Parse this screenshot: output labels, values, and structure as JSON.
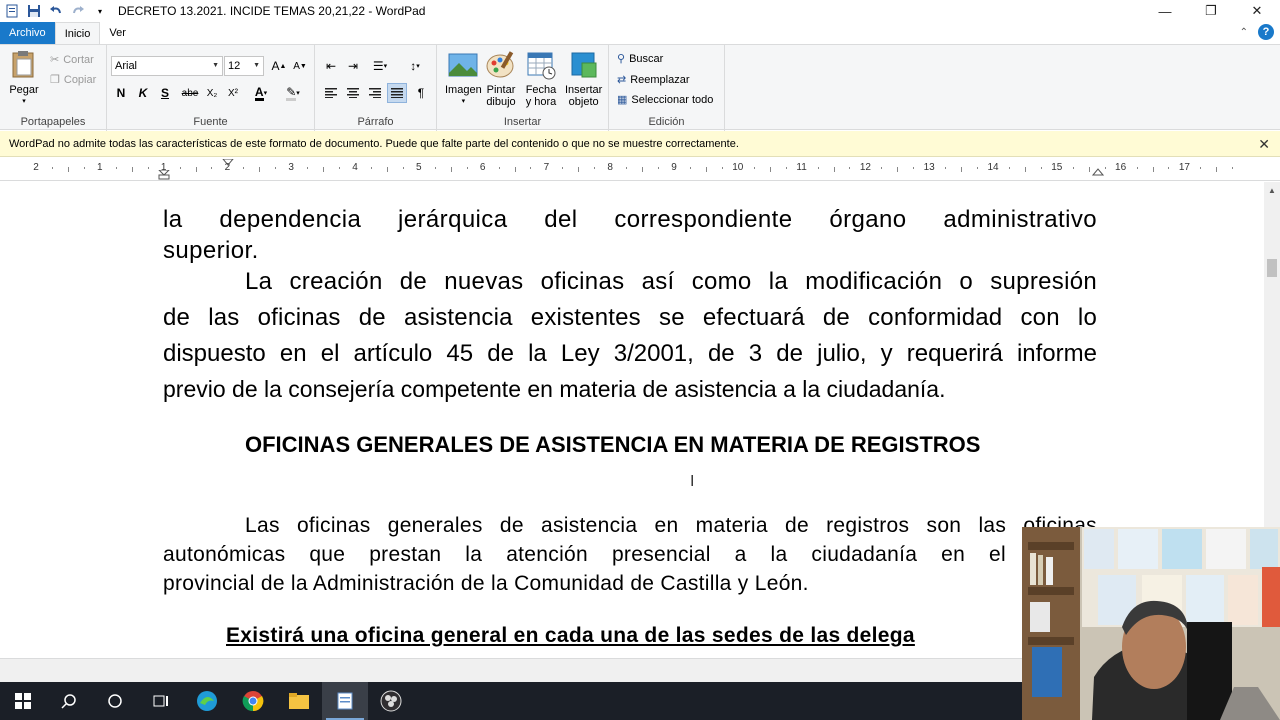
{
  "window": {
    "title": "DECRETO 13.2021. INCIDE TEMAS 20,21,22 - WordPad",
    "minimize": "—",
    "restore": "❐",
    "close": "✕"
  },
  "tabs": [
    "Archivo",
    "Inicio",
    "Ver"
  ],
  "ribbon": {
    "clipboard": {
      "label": "Portapapeles",
      "paste": "Pegar",
      "cut": "Cortar",
      "copy": "Copiar"
    },
    "font": {
      "label": "Fuente",
      "family": "Arial",
      "size": "12",
      "bold": "N",
      "italic": "K",
      "underline": "S",
      "strike": "abe",
      "sub": "X₂",
      "sup": "X²"
    },
    "paragraph": {
      "label": "Párrafo"
    },
    "insert": {
      "label": "Insertar",
      "image": "Imagen",
      "paint_line1": "Pintar",
      "paint_line2": "dibujo",
      "date_line1": "Fecha",
      "date_line2": "y hora",
      "object_line1": "Insertar",
      "object_line2": "objeto"
    },
    "editing": {
      "label": "Edición",
      "find": "Buscar",
      "replace": "Reemplazar",
      "select_all": "Seleccionar todo"
    }
  },
  "infobar": {
    "message": "WordPad no admite todas las características de este formato de documento. Puede que falte parte del contenido o que no se muestre correctamente."
  },
  "ruler": {
    "numbers": [
      "2",
      "1",
      "1",
      "2",
      "3",
      "4",
      "5",
      "6",
      "7",
      "8",
      "9",
      "10",
      "11",
      "12",
      "13",
      "14",
      "15",
      "16",
      "17"
    ]
  },
  "document": {
    "l1": "la dependencia jerárquica del correspondiente órgano administrativo",
    "l2": "superior.",
    "l3": "La creación de nuevas oficinas así como la modificación o supresión",
    "l4": "de las oficinas de asistencia existentes se efectuará de conformidad con lo",
    "l5": "dispuesto en el artículo 45 de la Ley 3/2001, de 3 de julio, y requerirá informe",
    "l6": "previo de la consejería competente en materia de asistencia a la ciudadanía.",
    "heading": "OFICINAS GENERALES DE ASISTENCIA EN MATERIA DE REGISTROS",
    "l7": "Las oficinas generales de asistencia en materia de registros son las oficinas",
    "l8": "autonómicas que prestan la atención presencial a la ciudadanía en el",
    "l9": "provincial de la Administración de la Comunidad de Castilla y León.",
    "l10": "Existirá una oficina general en cada una de las sedes de las delega"
  }
}
